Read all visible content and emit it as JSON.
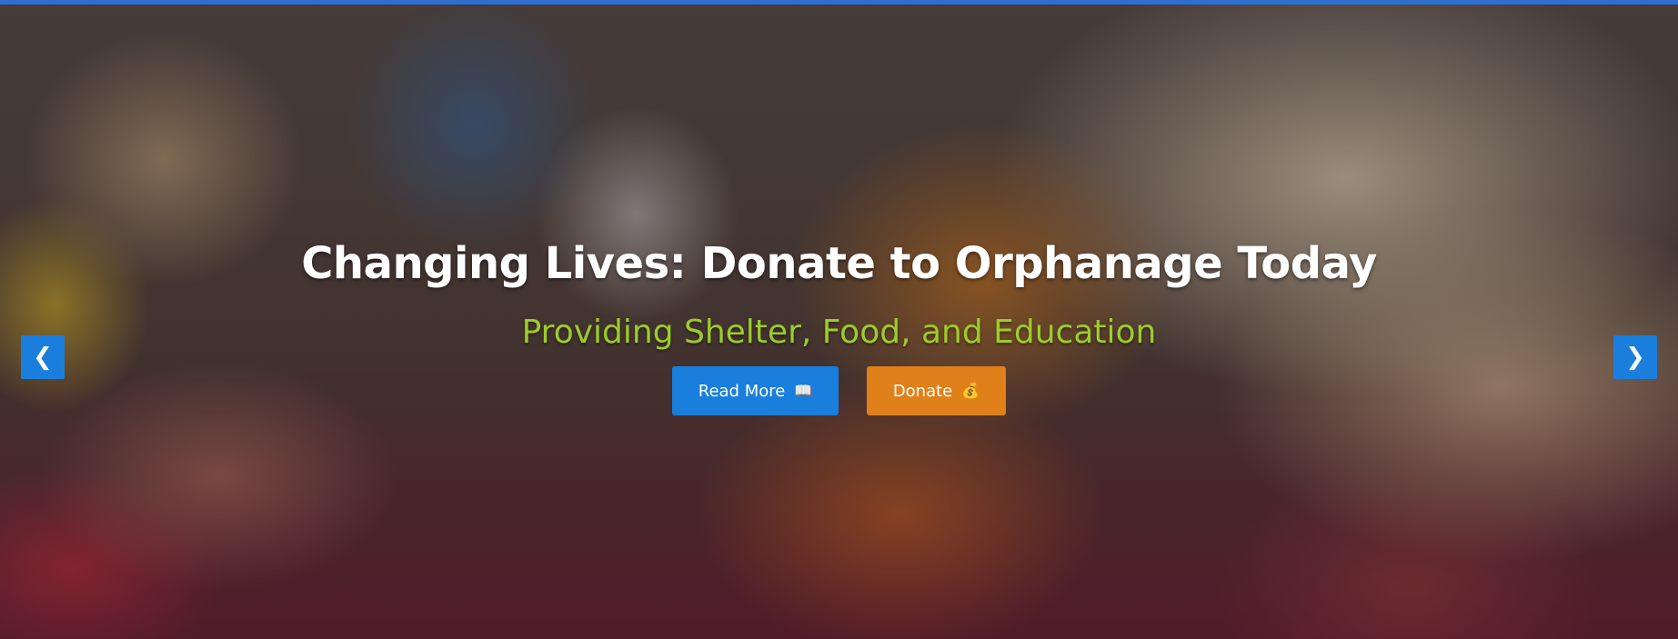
{
  "hero": {
    "title": "Changing Lives: Donate to Orphanage Today",
    "subtitle": "Providing Shelter, Food, and Education",
    "read_more_label": "Read More",
    "read_more_icon": "📖",
    "donate_label": "Donate",
    "donate_icon": "💰"
  },
  "carousel": {
    "prev_icon": "❮",
    "next_icon": "❯"
  },
  "colors": {
    "top_bar": "#2f6fd0",
    "primary_button": "#1a7fdc",
    "donate_button": "#e0801a",
    "subtitle": "#9ccc2a"
  }
}
